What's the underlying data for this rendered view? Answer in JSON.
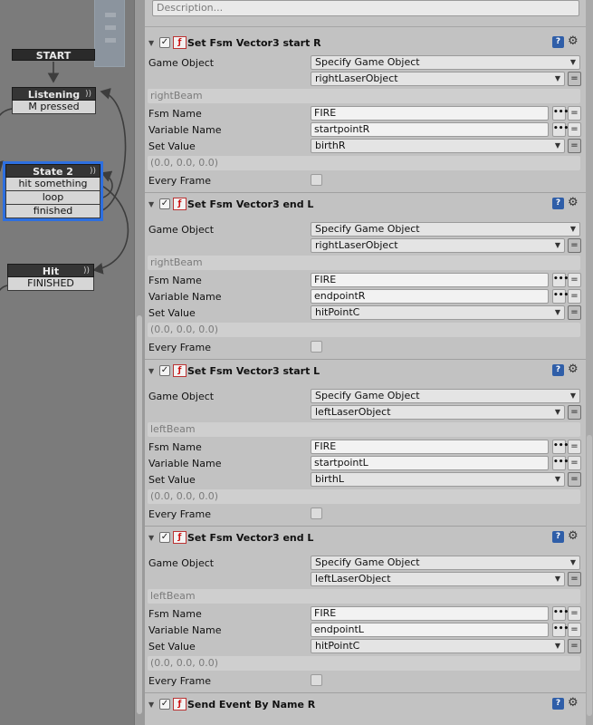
{
  "graph": {
    "states": [
      {
        "name": "START",
        "events": []
      },
      {
        "name": "Listening",
        "events": [
          "M pressed"
        ]
      },
      {
        "name": "State 2",
        "events": [
          "hit something",
          "loop",
          "finished"
        ]
      },
      {
        "name": "Hit",
        "events": [
          "FINISHED"
        ]
      }
    ],
    "selected_state": "State 2",
    "link_glyph": "))"
  },
  "inspector": {
    "description_placeholder": "Description...",
    "field_labels": {
      "game_object": "Game Object",
      "fsm_name": "Fsm Name",
      "variable_name": "Variable Name",
      "set_value": "Set Value",
      "every_frame": "Every Frame"
    },
    "glyphs": {
      "help": "?",
      "gear": "⚙",
      "dots": "•••",
      "eq": "=",
      "check": "✓",
      "fold": "▼",
      "caret": "▼",
      "action_icon": "ƒ"
    },
    "actions": [
      {
        "title": "Set Fsm Vector3 start R",
        "game_object_mode": "Specify Game Object",
        "game_object": "rightLaserObject",
        "resolved": "rightBeam",
        "fsm_name": "FIRE",
        "variable_name": "startpointR",
        "set_value": "birthR",
        "vector_value": "(0.0, 0.0, 0.0)"
      },
      {
        "title": "Set Fsm Vector3 end L",
        "game_object_mode": "Specify Game Object",
        "game_object": "rightLaserObject",
        "resolved": "rightBeam",
        "fsm_name": "FIRE",
        "variable_name": "endpointR",
        "set_value": "hitPointC",
        "vector_value": "(0.0, 0.0, 0.0)"
      },
      {
        "title": "Set Fsm Vector3 start L",
        "game_object_mode": "Specify Game Object",
        "game_object": "leftLaserObject",
        "resolved": "leftBeam",
        "fsm_name": "FIRE",
        "variable_name": "startpointL",
        "set_value": "birthL",
        "vector_value": "(0.0, 0.0, 0.0)"
      },
      {
        "title": "Set Fsm Vector3 end L",
        "game_object_mode": "Specify Game Object",
        "game_object": "leftLaserObject",
        "resolved": "leftBeam",
        "fsm_name": "FIRE",
        "variable_name": "endpointL",
        "set_value": "hitPointC",
        "vector_value": "(0.0, 0.0, 0.0)"
      }
    ],
    "last_action_title": "Send Event By Name R"
  },
  "colors": {
    "selection": "#2d6fe0",
    "graph_bg": "#7b7b7b",
    "inspector_bg": "#c2c2c2"
  }
}
